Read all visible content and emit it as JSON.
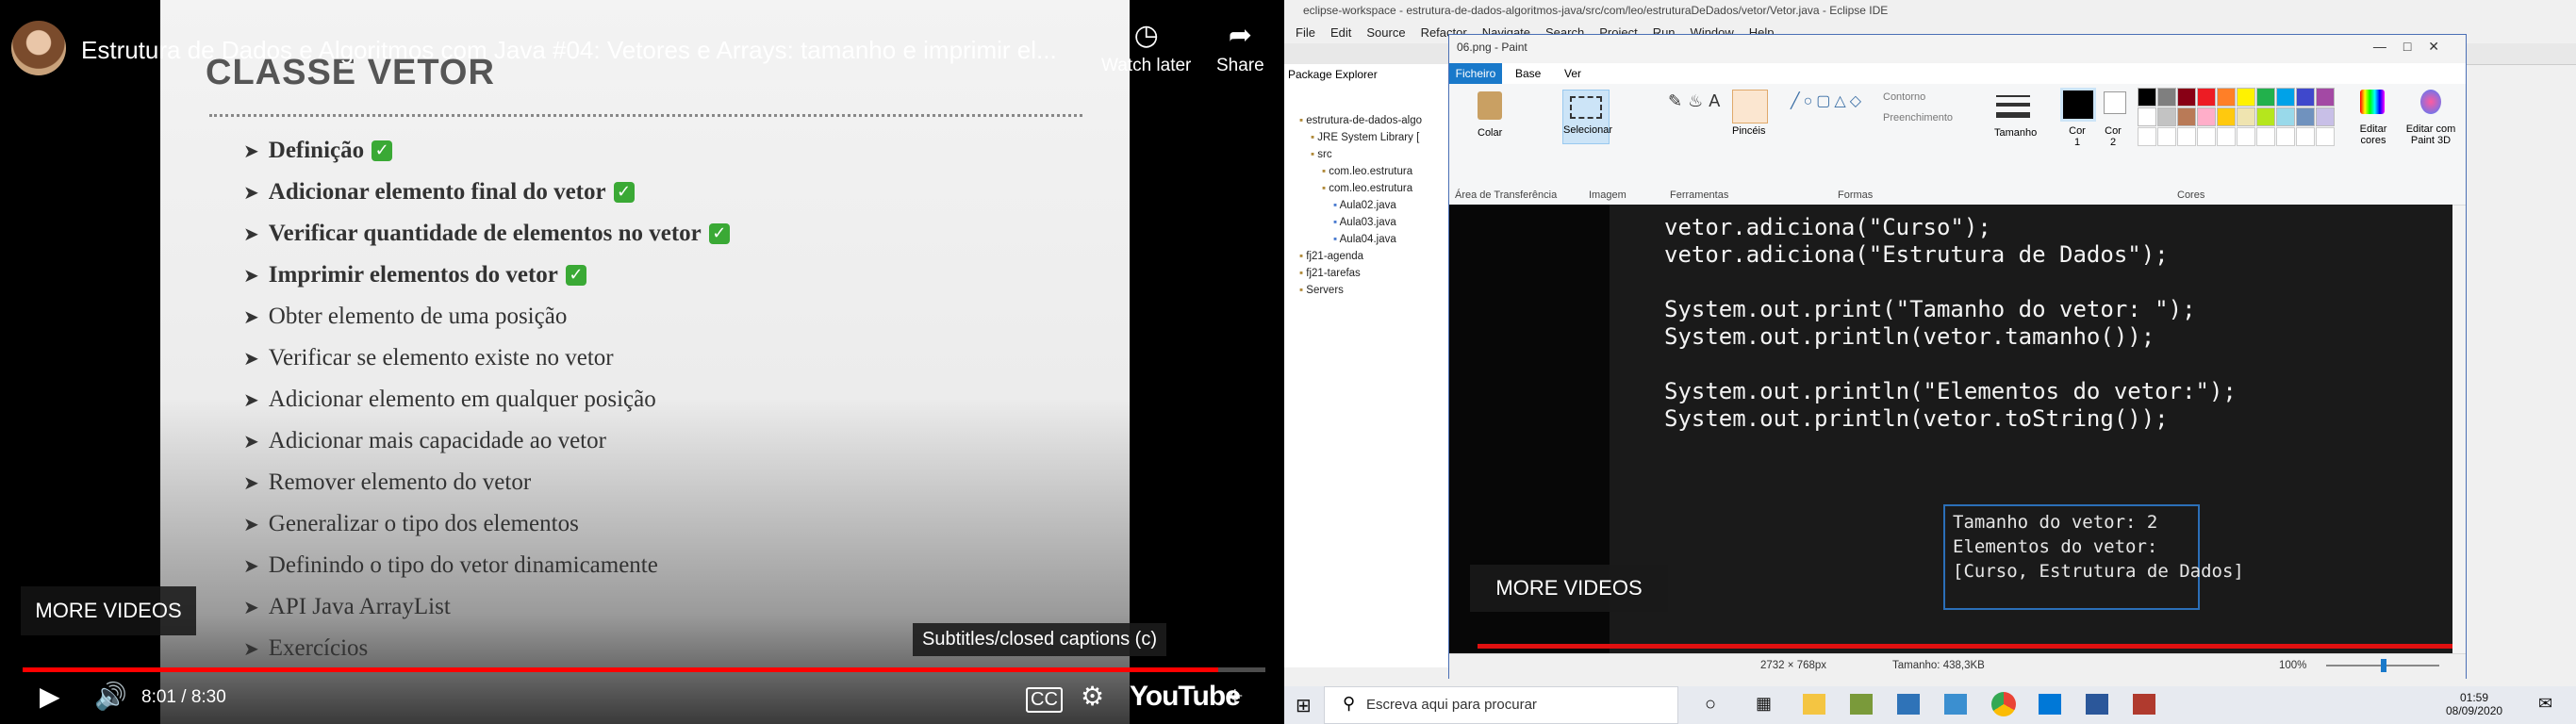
{
  "youtube": {
    "title": "Estrutura de Dados e Algoritmos com Java #04: Vetores e Arrays: tamanho e imprimir el...",
    "watch_later": "Watch later",
    "share": "Share",
    "slide": {
      "title": "CLASSE VETOR",
      "topics": [
        {
          "text": "Definição",
          "done": true
        },
        {
          "text": "Adicionar elemento final do vetor",
          "done": true
        },
        {
          "text": "Verificar quantidade de elementos no vetor",
          "done": true
        },
        {
          "text": "Imprimir elementos do vetor",
          "done": true
        },
        {
          "text": "Obter elemento de uma posição",
          "done": false
        },
        {
          "text": "Verificar se elemento existe no vetor",
          "done": false
        },
        {
          "text": "Adicionar elemento em qualquer posição",
          "done": false
        },
        {
          "text": "Adicionar mais capacidade ao vetor",
          "done": false
        },
        {
          "text": "Remover elemento do vetor",
          "done": false
        },
        {
          "text": "Generalizar o tipo dos elementos",
          "done": false
        },
        {
          "text": "Definindo o tipo do vetor dinamicamente",
          "done": false
        },
        {
          "text": "API Java ArrayList",
          "done": false
        },
        {
          "text": "Exercícios",
          "done": false
        }
      ]
    },
    "more_videos": "MORE VIDEOS",
    "cc_tooltip": "Subtitles/closed captions (c)",
    "time": "8:01 / 8:30",
    "progress": 0.962,
    "logo": "YouTube"
  },
  "eclipse": {
    "title": "eclipse-workspace - estrutura-de-dados-algoritmos-java/src/com/leo/estruturaDeDados/vetor/Vetor.java - Eclipse IDE",
    "menu": [
      "File",
      "Edit",
      "Source",
      "Refactor",
      "Navigate",
      "Search",
      "Project",
      "Run",
      "Window",
      "Help"
    ],
    "package_explorer": {
      "tab": "Package Explorer",
      "items": [
        {
          "label": "estrutura-de-dados-algo",
          "indent": 1
        },
        {
          "label": "JRE System Library [",
          "indent": 2
        },
        {
          "label": "src",
          "indent": 2
        },
        {
          "label": "com.leo.estrutura",
          "indent": 3
        },
        {
          "label": "com.leo.estrutura",
          "indent": 3
        },
        {
          "label": "Aula02.java",
          "indent": 4
        },
        {
          "label": "Aula03.java",
          "indent": 4
        },
        {
          "label": "Aula04.java",
          "indent": 4
        },
        {
          "label": "fj21-agenda",
          "indent": 1
        },
        {
          "label": "fj21-tarefas",
          "indent": 1
        },
        {
          "label": "Servers",
          "indent": 1
        }
      ]
    }
  },
  "paint": {
    "title": "06.png - Paint",
    "tabs": [
      "Ficheiro",
      "Base",
      "Ver"
    ],
    "ribbon": {
      "colar": "Colar",
      "selecionar": "Selecionar",
      "contorno": "Contorno",
      "preenchimento": "Preenchimento",
      "pinceis": "Pincéis",
      "tamanho": "Tamanho",
      "cor1": "Cor 1",
      "cor2": "Cor 2",
      "editar_cores": "Editar cores",
      "editar_paint3d": "Editar com Paint 3D",
      "groups": [
        "Área de Transferência",
        "Imagem",
        "Ferramentas",
        "Formas",
        "Cores"
      ]
    },
    "palette": [
      "#000000",
      "#7f7f7f",
      "#880015",
      "#ed1c24",
      "#ff7f27",
      "#fff200",
      "#22b14c",
      "#00a2e8",
      "#3f48cc",
      "#a349a4",
      "#ffffff",
      "#c3c3c3",
      "#b97a57",
      "#ffaec9",
      "#ffc90e",
      "#efe4b0",
      "#b5e61d",
      "#99d9ea",
      "#7092be",
      "#c8bfe7"
    ],
    "code": [
      "vetor.adiciona(\"Curso\");",
      "vetor.adiciona(\"Estrutura de Dados\");",
      "",
      "System.out.print(\"Tamanho do vetor: \");",
      "System.out.println(vetor.tamanho());",
      "",
      "System.out.println(\"Elementos do vetor:\");",
      "System.out.println(vetor.toString());"
    ],
    "output": [
      "Tamanho do vetor: 2",
      "Elementos do vetor:",
      "[Curso, Estrutura de Dados]"
    ],
    "more_videos": "MORE VIDEOS",
    "status": {
      "dimensions": "2732 × 768px",
      "size": "Tamanho: 438,3KB",
      "zoom": "100%"
    }
  },
  "taskbar": {
    "search_placeholder": "Escreva aqui para procurar",
    "time": "01:59",
    "date": "08/09/2020"
  }
}
